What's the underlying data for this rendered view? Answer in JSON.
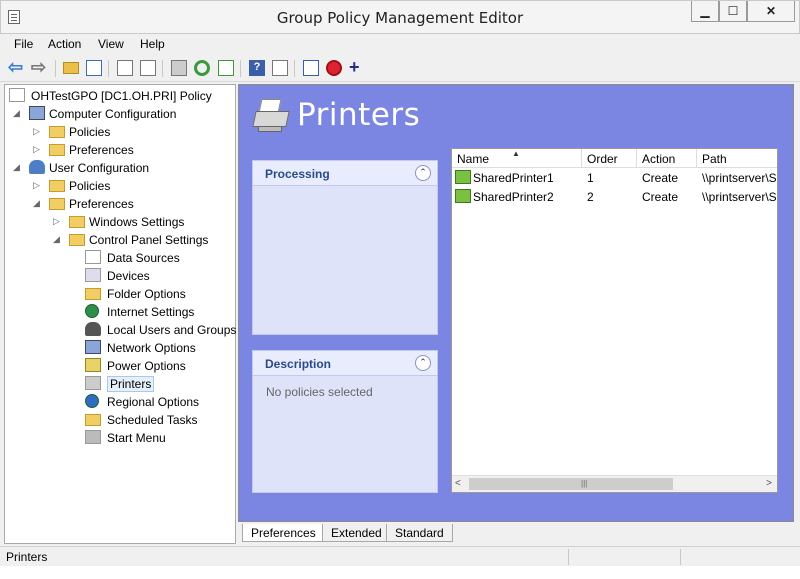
{
  "window": {
    "title": "Group Policy Management Editor",
    "min": "▁",
    "max": "☐",
    "close": "✕"
  },
  "menu": [
    "File",
    "Action",
    "View",
    "Help"
  ],
  "toolbar": {
    "icons": [
      "back-icon",
      "forward-icon",
      "up-folder-icon",
      "show-hide-tree-icon",
      "copy-icon",
      "paste-icon",
      "print-icon",
      "refresh-icon",
      "export-icon",
      "help-icon",
      "properties-icon",
      "gpo-status-icon",
      "disable-icon",
      "add-icon"
    ],
    "help_glyph": "?",
    "add_glyph": "+",
    "back_glyph": "⇦",
    "forward_glyph": "⇨"
  },
  "tree": {
    "root": "OHTestGPO [DC1.OH.PRI] Policy",
    "computer_config": "Computer Configuration",
    "cc_policies": "Policies",
    "cc_preferences": "Preferences",
    "user_config": "User Configuration",
    "uc_policies": "Policies",
    "uc_preferences": "Preferences",
    "windows_settings": "Windows Settings",
    "control_panel": "Control Panel Settings",
    "items": [
      "Data Sources",
      "Devices",
      "Folder Options",
      "Internet Settings",
      "Local Users and Groups",
      "Network Options",
      "Power Options",
      "Printers",
      "Regional Options",
      "Scheduled Tasks",
      "Start Menu"
    ],
    "selected": "Printers",
    "expanded_glyph": "◢",
    "collapsed_glyph": "▷"
  },
  "pane": {
    "title": "Printers",
    "processing": {
      "header": "Processing",
      "collapse_glyph": "⌃"
    },
    "description": {
      "header": "Description",
      "text": "No policies selected",
      "collapse_glyph": "⌃"
    }
  },
  "list": {
    "columns": [
      "Name",
      "Order",
      "Action",
      "Path"
    ],
    "sort_glyph": "▲",
    "rows": [
      {
        "name": "SharedPrinter1",
        "order": "1",
        "action": "Create",
        "path": "\\\\printserver\\S"
      },
      {
        "name": "SharedPrinter2",
        "order": "2",
        "action": "Create",
        "path": "\\\\printserver\\S"
      }
    ],
    "scroll": {
      "left": "<",
      "right": ">",
      "grip": "|||"
    }
  },
  "tabs": [
    "Preferences",
    "Extended",
    "Standard"
  ],
  "active_tab": "Preferences",
  "status": "Printers"
}
